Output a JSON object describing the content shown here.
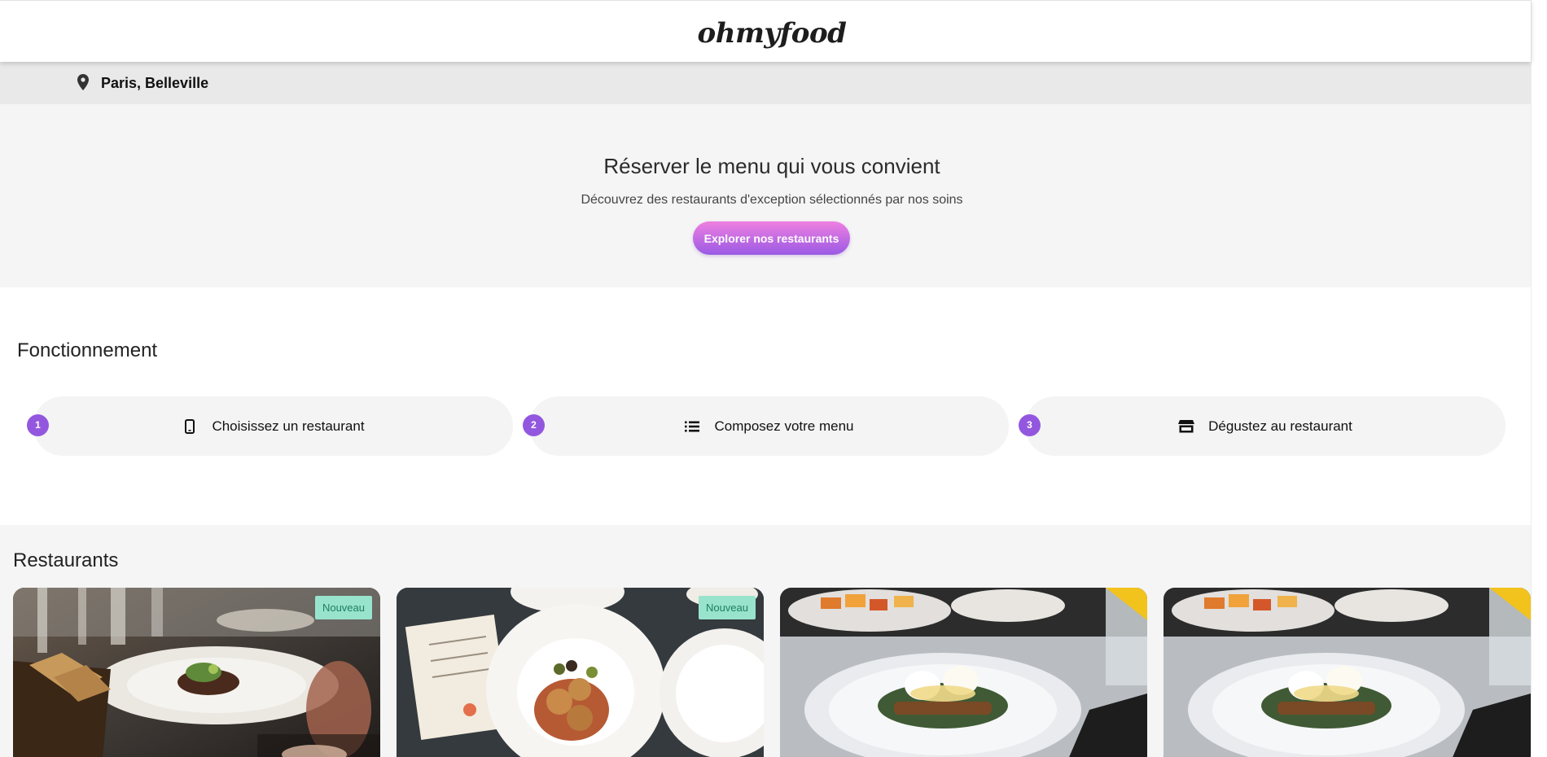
{
  "header": {
    "logo": "ohmyfood"
  },
  "location": {
    "icon": "map-pin-icon",
    "label": "Paris, Belleville"
  },
  "hero": {
    "title": "Réserver le menu qui vous convient",
    "subtitle": "Découvrez des restaurants d'exception sélectionnés par nos soins",
    "cta_label": "Explorer nos restaurants"
  },
  "steps": {
    "title": "Fonctionnement",
    "items": [
      {
        "number": "1",
        "icon": "smartphone-icon",
        "label": "Choisissez un restaurant"
      },
      {
        "number": "2",
        "icon": "list-icon",
        "label": "Composez votre menu"
      },
      {
        "number": "3",
        "icon": "store-icon",
        "label": "Dégustez au restaurant"
      }
    ]
  },
  "restaurants": {
    "title": "Restaurants",
    "cards": [
      {
        "badge": "Nouveau"
      },
      {
        "badge": "Nouveau"
      },
      {
        "badge": ""
      },
      {
        "badge": ""
      }
    ]
  },
  "colors": {
    "accent_purple": "#9357df",
    "cta_gradient_top": "#ef7fe0",
    "cta_gradient_bottom": "#9a5ae4",
    "badge_bg": "#98e3cc",
    "badge_text": "#1f7d63"
  }
}
